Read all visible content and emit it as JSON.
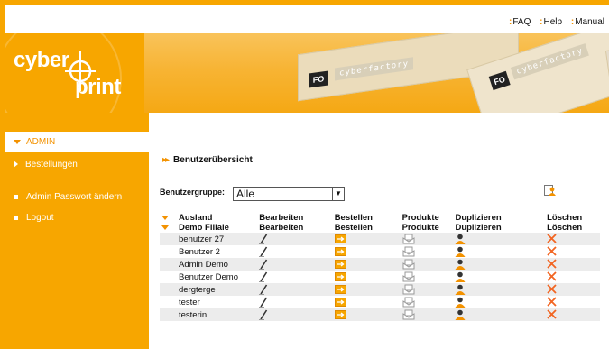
{
  "toplinks": [
    {
      "label": "FAQ"
    },
    {
      "label": "Help"
    },
    {
      "label": "Manual"
    }
  ],
  "logo": {
    "part1": "cyber",
    "part2": "print"
  },
  "banner": {
    "box_text1": "cyberfactory",
    "box_text2": "cyberfactory",
    "mark": "FO"
  },
  "sidebar": {
    "items": [
      {
        "label": "ADMIN",
        "type": "section-open"
      },
      {
        "label": "Bestellungen",
        "type": "arrow"
      },
      {
        "label": "Admin Passwort ändern",
        "type": "bullet"
      },
      {
        "label": "Logout",
        "type": "bullet"
      }
    ]
  },
  "main": {
    "title": "Benutzerübersicht",
    "filter_label": "Benutzergruppe:",
    "filter_value": "Alle",
    "table": {
      "header1": [
        "Ausland",
        "Bearbeiten",
        "Bestellen",
        "Produkte",
        "Duplizieren",
        "Löschen"
      ],
      "header2": [
        "Demo Filiale",
        "Bearbeiten",
        "Bestellen",
        "Produkte",
        "Duplizieren",
        "Löschen"
      ],
      "rows": [
        "benutzer 27",
        "Benutzer 2",
        "Admin Demo",
        "Benutzer Demo",
        "dergterge",
        "tester",
        "testerin"
      ]
    }
  },
  "colors": {
    "accent": "#f7a600",
    "arrow": "#f39200",
    "delete": "#f26522",
    "row_alt": "#ececec"
  }
}
